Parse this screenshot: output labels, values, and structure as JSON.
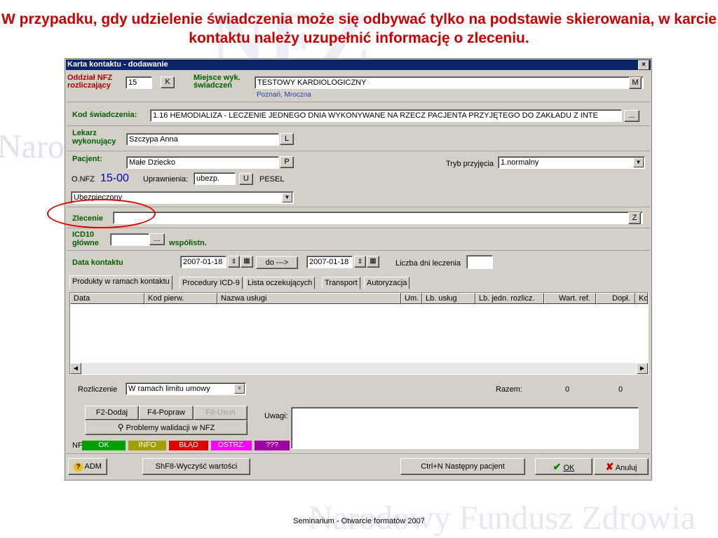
{
  "slide": {
    "headline": "W przypadku, gdy udzielenie świadczenia może się odbywać tylko na podstawie skierowania, w karcie kontaktu należy uzupełnić informację o zleceniu.",
    "watermark": "Narodowy Fundusz Zdrowia",
    "watermark_logo": "NFZ",
    "watermark_left": "Naro",
    "footer": "Seminarium - Otwarcie formatów 2007"
  },
  "window": {
    "title": "Karta kontaktu - dodawanie",
    "close": "×"
  },
  "oddzial": {
    "label": "Oddział NFZ rozliczający",
    "value": "15",
    "btn": "K"
  },
  "miejsce": {
    "label": "Miejsce wyk. świadczeń",
    "value": "TESTOWY KARDIOLOGICZNY",
    "sub": "Poznań, Mroczna",
    "btn": "M"
  },
  "kod": {
    "label": "Kod świadczenia:",
    "value": "1.16 HEMODIALIZA - LECZENIE JEDNEGO DNIA WYKONYWANE NA RZECZ PACJENTA PRZYJĘTEGO DO ZAKŁADU Z INTE",
    "btn": "..."
  },
  "lekarz": {
    "label": "Lekarz wykonujący",
    "value": "Szczypa Anna",
    "btn": "L"
  },
  "pacjent": {
    "label": "Pacjent:",
    "value": "Małe Dziecko",
    "btn": "P",
    "tryb_label": "Tryb przyjęcia",
    "tryb_value": "1.normalny",
    "onfz_label": "O.NFZ",
    "onfz_value": "15-00",
    "upr_label": "Uprawnienia:",
    "upr_value": "ubezp.",
    "upr_btn": "U",
    "pesel_label": "PESEL",
    "status_value": "Ubezpieczony"
  },
  "zlecenie": {
    "label": "Zlecenie",
    "value": "",
    "btn": "Z"
  },
  "icd": {
    "label": "ICD10 główne",
    "btn": "...",
    "wsp_label": "współistn."
  },
  "data_kontaktu": {
    "label": "Data kontaktu",
    "from": "2007-01-18",
    "do_btn": "do --->",
    "to": "2007-01-18",
    "dni_label": "Liczba dni leczenia",
    "dni_value": ""
  },
  "tabs": [
    "Produkty w ramach kontaktu",
    "Procedury ICD-9",
    "Lista oczekujących",
    "Transport",
    "Autoryzacja"
  ],
  "columns": [
    "Data",
    "Kod pierw.",
    "Nazwa usługi",
    "Um.",
    "Lb. usług",
    "Lb. jedn. rozlicz.",
    "Wart. ref.",
    "Dopł.",
    "Ko"
  ],
  "rozliczenie": {
    "label": "Rozliczenie",
    "value": "W ramach limitu umowy",
    "razem_label": "Razem:",
    "razem_1": "0",
    "razem_2": "0"
  },
  "buttons": {
    "dodaj": "F2-Dodaj",
    "popraw": "F4-Popraw",
    "usun": "F8-Usuń",
    "problemy": "Problemy walidacji w NFZ",
    "uwagi_label": "Uwagi:"
  },
  "nfz_status": {
    "label": "NFZ:",
    "items": [
      {
        "text": "OK",
        "color": "#00a000"
      },
      {
        "text": "INFO",
        "color": "#a0a000"
      },
      {
        "text": "BŁĄD",
        "color": "#e00000"
      },
      {
        "text": "OSTRZ.",
        "color": "#ff00ff"
      },
      {
        "text": "???",
        "color": "#a000a0"
      }
    ]
  },
  "bottom": {
    "adm": "ADM",
    "clear": "ShF8-Wyczyść wartości",
    "next": "Ctrl+N Następny pacjent",
    "ok": "OK",
    "cancel": "Anuluj"
  },
  "colors": {
    "headline": "#cc0000",
    "titlebar": "#0a246a",
    "label_blue": "#0000a0",
    "label_red": "#b00000",
    "highlight_circle": "#e00000"
  }
}
